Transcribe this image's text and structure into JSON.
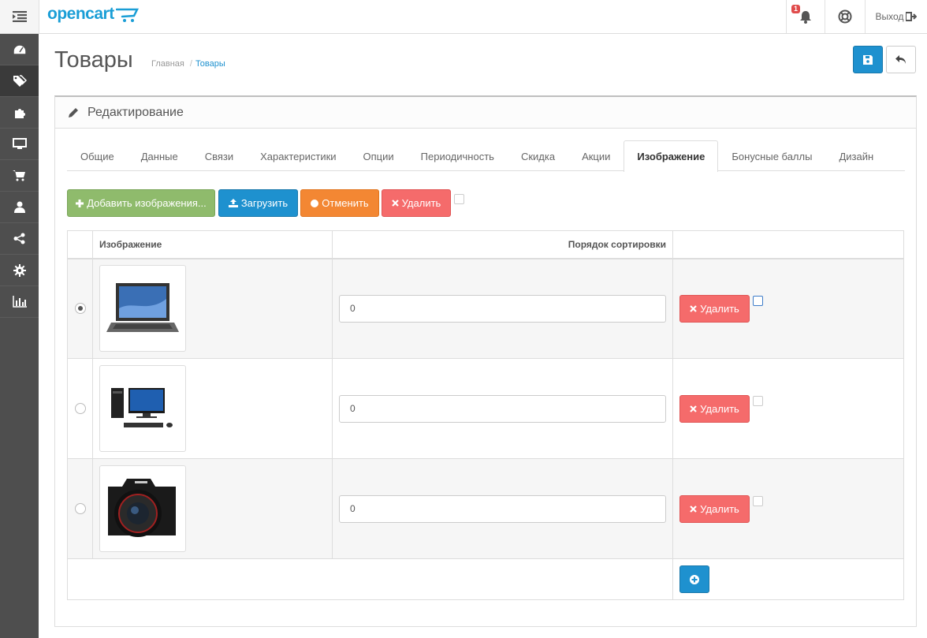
{
  "header": {
    "logo": "opencart",
    "notifications_count": "1",
    "logout_label": "Выход"
  },
  "sidebar": {
    "items": [
      {
        "icon": "dashboard-icon"
      },
      {
        "icon": "tag-icon",
        "active": true
      },
      {
        "icon": "puzzle-icon"
      },
      {
        "icon": "desktop-icon"
      },
      {
        "icon": "cart-icon"
      },
      {
        "icon": "user-icon"
      },
      {
        "icon": "share-icon"
      },
      {
        "icon": "gear-icon"
      },
      {
        "icon": "bar-chart-icon"
      }
    ]
  },
  "page": {
    "title": "Товары",
    "breadcrumb": [
      "Главная",
      "Товары"
    ]
  },
  "panel": {
    "heading": "Редактирование"
  },
  "tabs": [
    "Общие",
    "Данные",
    "Связи",
    "Характеристики",
    "Опции",
    "Периодичность",
    "Скидка",
    "Акции",
    "Изображение",
    "Бонусные баллы",
    "Дизайн"
  ],
  "active_tab": "Изображение",
  "toolbar": {
    "add_label": "Добавить изображения...",
    "upload_label": "Загрузить",
    "cancel_label": "Отменить",
    "delete_label": "Удалить"
  },
  "table": {
    "headers": [
      "Изображение",
      "Порядок сортировки"
    ],
    "rows": [
      {
        "image": "laptop",
        "sort_order": "0",
        "delete_label": "Удалить",
        "main": true
      },
      {
        "image": "desktop-computer",
        "sort_order": "0",
        "delete_label": "Удалить",
        "main": false
      },
      {
        "image": "camera",
        "sort_order": "0",
        "delete_label": "Удалить",
        "main": false
      }
    ]
  },
  "colors": {
    "primary": "#1e91cf",
    "success": "#8fbb6c",
    "warning": "#f38733",
    "danger": "#f56b6b",
    "sidebar": "#4e4e4e"
  }
}
